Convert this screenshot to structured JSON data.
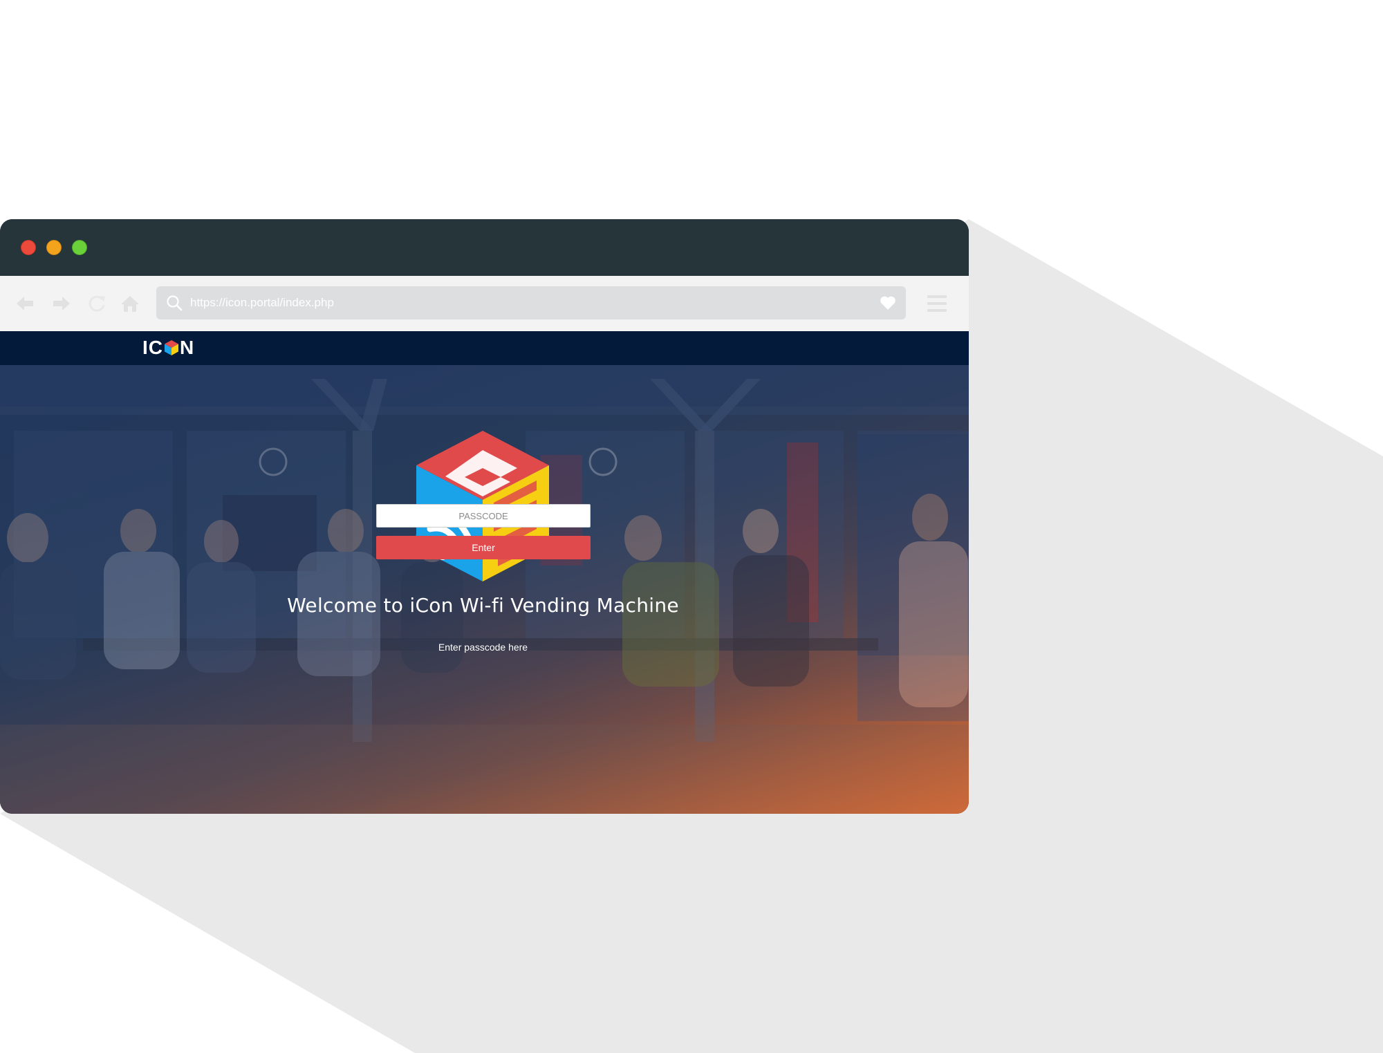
{
  "browser": {
    "url": "https://icon.portal/index.php",
    "icons": {
      "close": "close-dot-icon",
      "minimize": "minimize-dot-icon",
      "maximize": "maximize-dot-icon",
      "fullscreen": "expand-arrows-icon",
      "back": "arrow-left-icon",
      "forward": "arrow-right-icon",
      "reload": "reload-icon",
      "home": "home-icon",
      "search": "search-icon",
      "bookmark": "heart-icon",
      "menu": "hamburger-menu-icon"
    }
  },
  "site": {
    "logo_text": "ICON",
    "welcome": "Welcome to iCon Wi-fi Vending Machine",
    "passcode_label": "Enter passcode here",
    "passcode_placeholder": "PASSCODE",
    "passcode_value": "",
    "enter_label": "Enter"
  },
  "colors": {
    "window_titlebar": "#263539",
    "site_navbar": "#041a3a",
    "enter_button": "#e04a4c",
    "logo_red": "#e14a4b",
    "logo_blue": "#1aa3e8",
    "logo_yellow": "#f6cf12"
  }
}
